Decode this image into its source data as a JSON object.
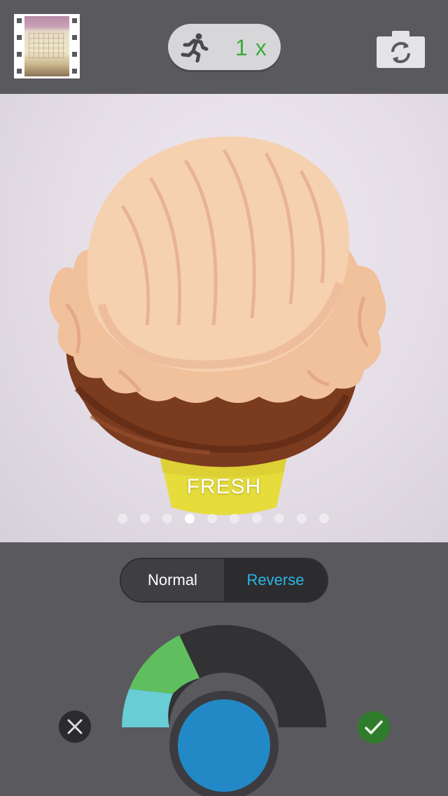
{
  "header": {
    "speed_label": "1 x",
    "icons": {
      "gallery": "film-strip-thumbnail",
      "speed": "running-man-icon",
      "flip": "camera-flip-icon"
    }
  },
  "preview": {
    "filter_name": "FRESH",
    "pager": {
      "count": 10,
      "active_index": 3
    }
  },
  "playback_mode": {
    "options": [
      "Normal",
      "Reverse"
    ],
    "selected": "Reverse"
  },
  "dial": {
    "segments": [
      "#68cdd5",
      "#5fbf5f",
      "#323134"
    ],
    "knob_color": "#2289c6"
  },
  "actions": {
    "cancel_icon": "close-icon",
    "confirm_icon": "checkmark-icon"
  },
  "colors": {
    "accent_blue": "#2ab7e4",
    "speed_green": "#3eaa3a",
    "confirm_green": "#2f7d2c"
  }
}
